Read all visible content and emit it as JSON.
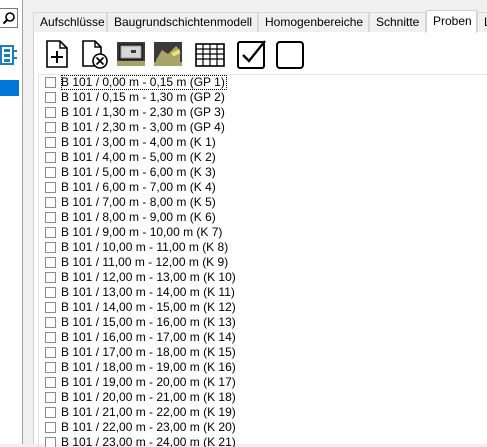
{
  "tabs": [
    {
      "label": "Aufschlüsse",
      "active": false
    },
    {
      "label": "Baugrundschichtenmodell",
      "active": false
    },
    {
      "label": "Homogenbereiche",
      "active": false
    },
    {
      "label": "Schnitte",
      "active": false
    },
    {
      "label": "Proben",
      "active": true
    },
    {
      "label": "L",
      "active": false
    }
  ],
  "toolbar": {
    "icons": [
      "new-sample-icon",
      "delete-sample-icon",
      "import-icon",
      "export-icon",
      "table-icon",
      "check-all-icon",
      "uncheck-all-icon"
    ]
  },
  "samples": [
    "B 101 / 0,00 m - 0,15 m (GP 1)",
    "B 101 / 0,15 m - 1,30 m (GP 2)",
    "B 101 / 1,30 m - 2,30 m (GP 3)",
    "B 101 / 2,30 m - 3,00 m (GP 4)",
    "B 101 / 3,00 m - 4,00 m (K 1)",
    "B 101 / 4,00 m - 5,00 m (K 2)",
    "B 101 / 5,00 m - 6,00 m (K 3)",
    "B 101 / 6,00 m - 7,00 m (K 4)",
    "B 101 / 7,00 m - 8,00 m (K 5)",
    "B 101 / 8,00 m - 9,00 m (K 6)",
    "B 101 / 9,00 m - 10,00 m (K 7)",
    "B 101 / 10,00 m - 11,00 m (K 8)",
    "B 101 / 11,00 m - 12,00 m (K 9)",
    "B 101 / 12,00 m - 13,00 m (K 10)",
    "B 101 / 13,00 m - 14,00 m (K 11)",
    "B 101 / 14,00 m - 15,00 m (K 12)",
    "B 101 / 15,00 m - 16,00 m (K 13)",
    "B 101 / 16,00 m - 17,00 m (K 14)",
    "B 101 / 17,00 m - 18,00 m (K 15)",
    "B 101 / 18,00 m - 19,00 m (K 16)",
    "B 101 / 19,00 m - 20,00 m (K 17)",
    "B 101 / 20,00 m - 21,00 m (K 18)",
    "B 101 / 21,00 m - 22,00 m (K 19)",
    "B 101 / 22,00 m - 23,00 m (K 20)",
    "B 101 / 23,00 m - 24,00 m (K 21)"
  ],
  "colors": {
    "selection": "#0078d7",
    "icon_olive": "#a7a46a",
    "icon_dark": "#3a3a3a"
  }
}
